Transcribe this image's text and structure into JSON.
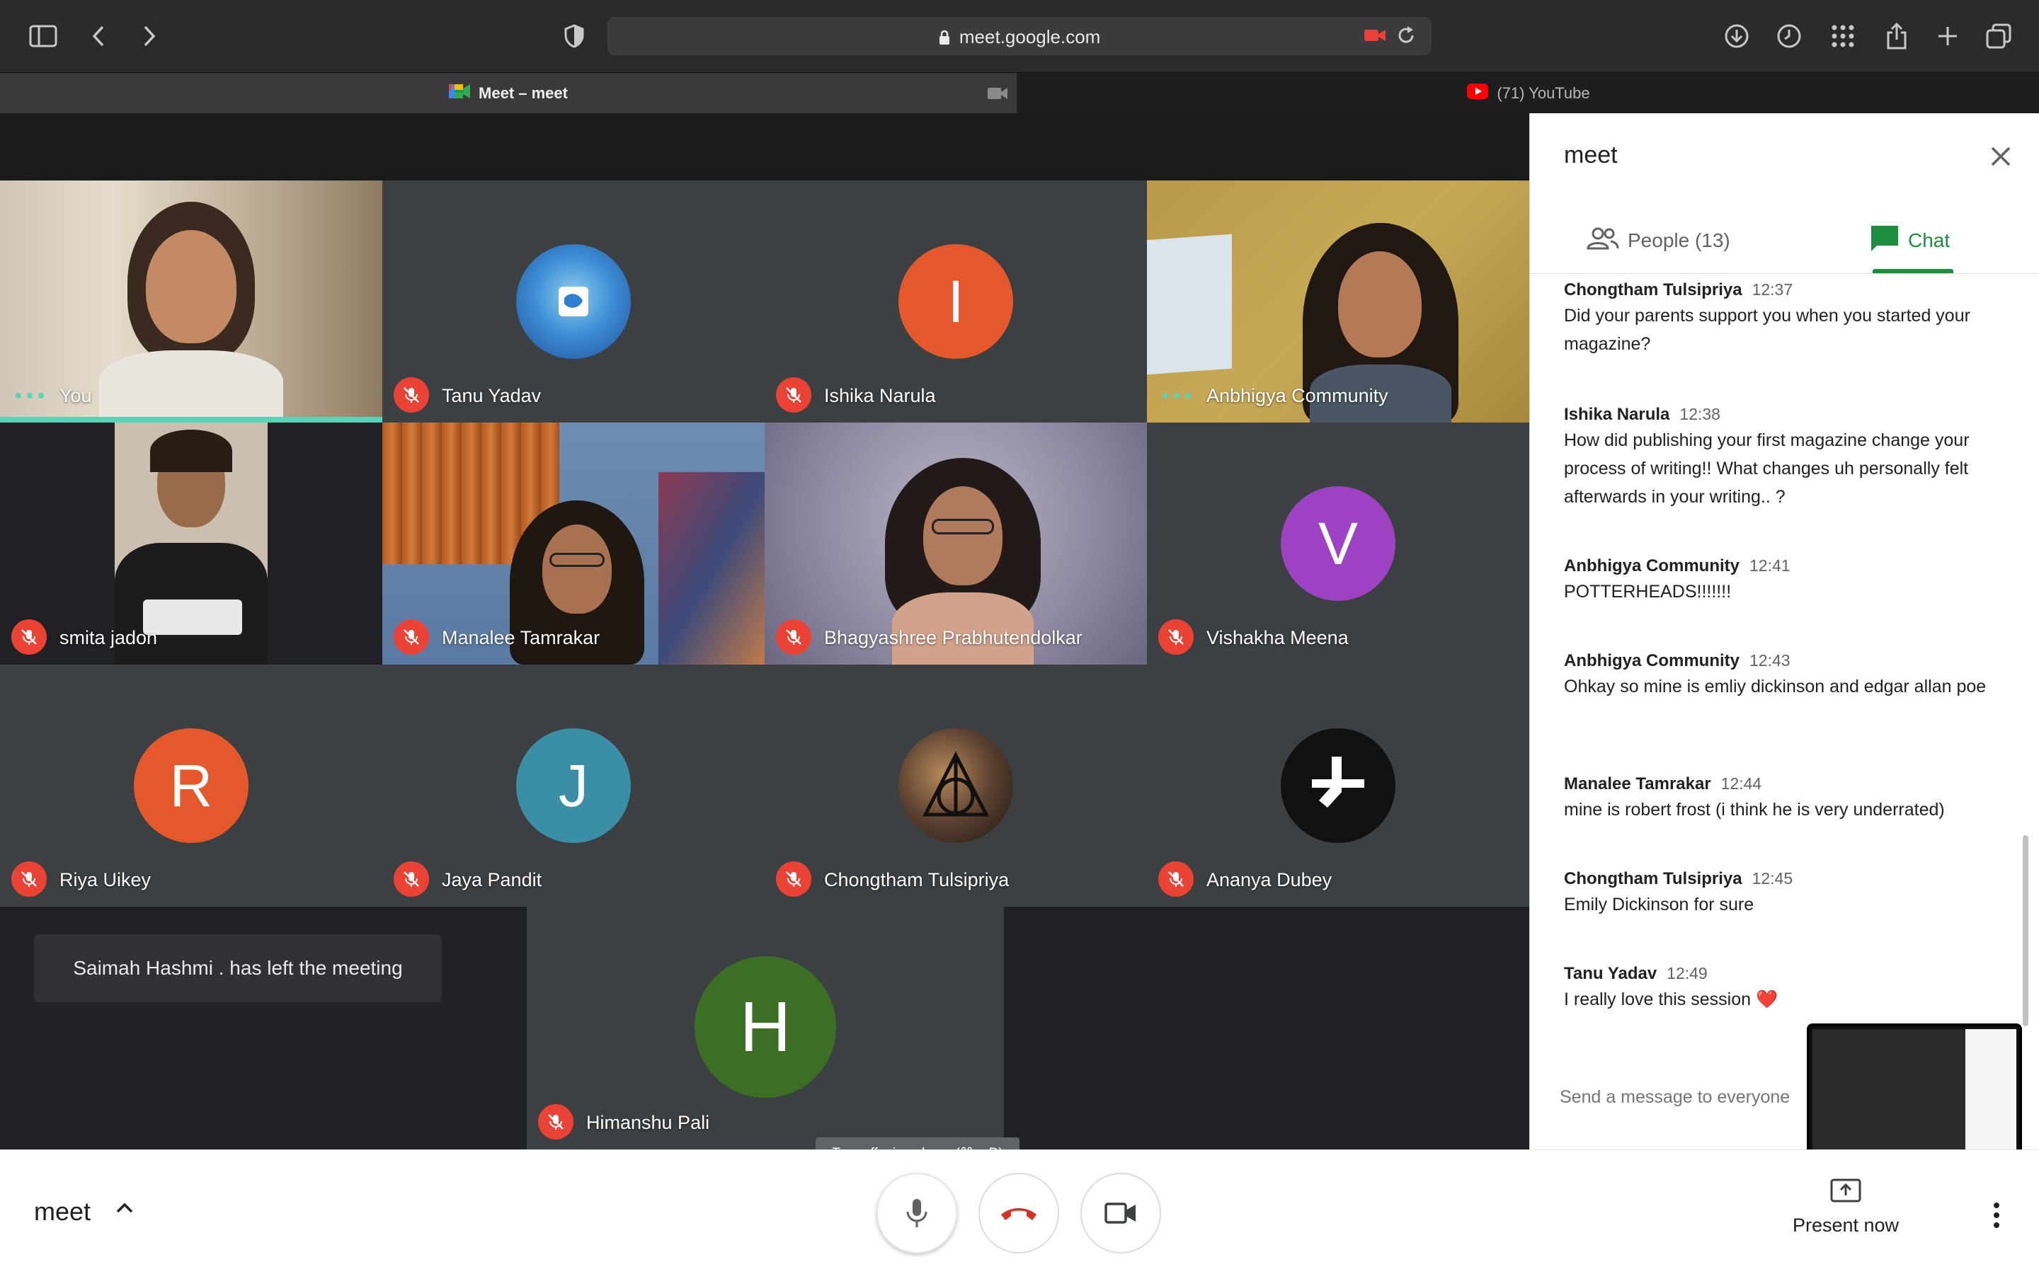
{
  "browser": {
    "url": "meet.google.com",
    "tabs": [
      {
        "label": "Meet – meet",
        "active": true
      },
      {
        "label": "(71) YouTube",
        "active": false
      }
    ]
  },
  "tiles": [
    {
      "name": "You",
      "status": "speaking-dots",
      "avatar": null
    },
    {
      "name": "Tanu Yadav",
      "status": "muted",
      "avatar": "photo"
    },
    {
      "name": "Ishika Narula",
      "status": "muted",
      "avatar": "I",
      "avatar_color": "#e4582b"
    },
    {
      "name": "Anbhigya Community",
      "status": "speaking-dots",
      "avatar": null
    },
    {
      "name": "smita jadon",
      "status": "muted",
      "avatar": null
    },
    {
      "name": "Manalee Tamrakar",
      "status": "muted",
      "avatar": null
    },
    {
      "name": "Bhagyashree Prabhutendolkar",
      "status": "muted",
      "avatar": null
    },
    {
      "name": "Vishakha Meena",
      "status": "muted",
      "avatar": "V",
      "avatar_color": "#9c42c2"
    },
    {
      "name": "Riya Uikey",
      "status": "muted",
      "avatar": "R",
      "avatar_color": "#e4582b"
    },
    {
      "name": "Jaya Pandit",
      "status": "muted",
      "avatar": "J",
      "avatar_color": "#3a8fa6"
    },
    {
      "name": "Chongtham Tulsipriya",
      "status": "muted",
      "avatar": "photo"
    },
    {
      "name": "Ananya Dubey",
      "status": "muted",
      "avatar": "photo"
    },
    {
      "name": "Himanshu Pali",
      "status": "muted",
      "avatar": "H",
      "avatar_color": "#3c6e24"
    }
  ],
  "notice": "Saimah Hashmi . has left the meeting",
  "tooltip": "Turn off microphone (⌘ + D)",
  "panel": {
    "title": "meet",
    "people_tab": "People (13)",
    "chat_tab": "Chat",
    "input_placeholder": "Send a message to everyone",
    "messages": [
      {
        "sender": "Chongtham Tulsipriya",
        "time": "12:37",
        "text": "Did your parents support you when you started your magazine?"
      },
      {
        "sender": "Ishika Narula",
        "time": "12:38",
        "text": "How did publishing your first magazine change your process of writing!! What changes uh personally felt afterwards in your writing.. ?"
      },
      {
        "sender": "Anbhigya Community",
        "time": "12:41",
        "text": "POTTERHEADS!!!!!!!"
      },
      {
        "sender": "Anbhigya Community",
        "time": "12:43",
        "text": "Ohkay so mine is emliy dickinson and edgar allan poe"
      },
      {
        "sender": "Manalee Tamrakar",
        "time": "12:44",
        "text": "mine is robert frost (i think he is very underrated)"
      },
      {
        "sender": "Chongtham Tulsipriya",
        "time": "12:45",
        "text": "Emily Dickinson for sure"
      },
      {
        "sender": "Tanu Yadav",
        "time": "12:49",
        "text": "I really love this session ❤️"
      }
    ]
  },
  "bottom": {
    "meeting_name": "meet",
    "present_label": "Present now"
  },
  "colors": {
    "muted": "#ea4335",
    "chat_accent": "#1e8e3e",
    "active_speaker": "#5bd1b6"
  }
}
